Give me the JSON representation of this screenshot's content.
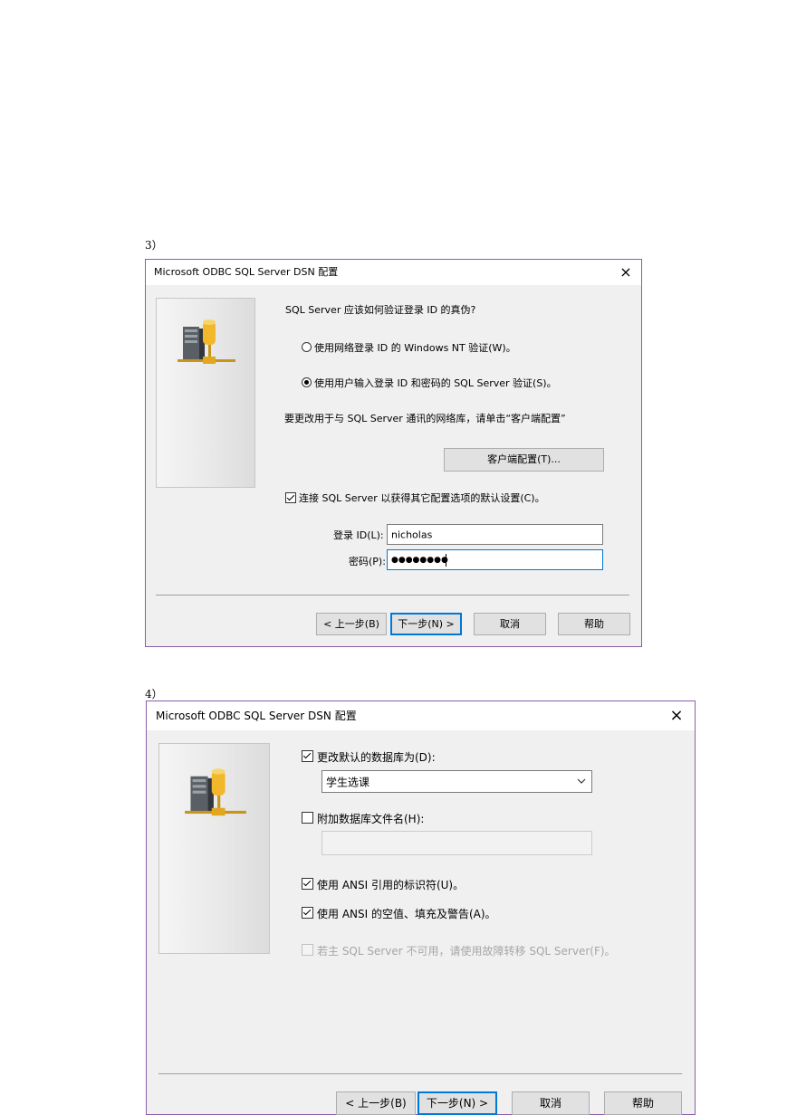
{
  "steps": {
    "step3_label": "3）",
    "step4_label": "4）"
  },
  "dialog3": {
    "title": "Microsoft ODBC SQL Server DSN 配置",
    "close_glyph": "×",
    "question": "SQL Server 应该如何验证登录 ID 的真伪?",
    "radio_windows_label": "使用网络登录 ID 的 Windows NT 验证(W)。",
    "radio_sql_label": "使用用户输入登录 ID 和密码的 SQL Server 验证(S)。",
    "radio_selected": "sql",
    "network_info": "要更改用于与 SQL Server 通讯的网络库，请单击“客户端配置”",
    "client_config_label": "客户端配置(T)...",
    "connect_checkbox_label": "连接 SQL Server 以获得其它配置选项的默认设置(C)。",
    "connect_checked": true,
    "login_label": "登录 ID(L):",
    "login_value": "nicholas",
    "password_label": "密码(P):",
    "password_mask": "●●●●●●●●",
    "buttons": {
      "back": "< 上一步(B)",
      "next": "下一步(N) >",
      "cancel": "取消",
      "help": "帮助"
    }
  },
  "dialog4": {
    "title": "Microsoft ODBC SQL Server DSN 配置",
    "close_glyph": "×",
    "change_db_label": "更改默认的数据库为(D):",
    "change_db_checked": true,
    "database_value": "学生选课",
    "attach_db_label": "附加数据库文件名(H):",
    "attach_db_checked": false,
    "attach_db_value": "",
    "ansi_quoted_label": "使用 ANSI 引用的标识符(U)。",
    "ansi_quoted_checked": true,
    "ansi_nulls_label": "使用 ANSI 的空值、填充及警告(A)。",
    "ansi_nulls_checked": true,
    "failover_label": "若主 SQL Server 不可用，请使用故障转移 SQL Server(F)。",
    "failover_checked": false,
    "buttons": {
      "back": "< 上一步(B)",
      "next": "下一步(N) >",
      "cancel": "取消",
      "help": "帮助"
    }
  },
  "icons": {
    "server": "server-network-icon",
    "dropdown": "chevron-down-icon",
    "close": "close-icon"
  },
  "colors": {
    "focus_border": "#0078d7",
    "dialog_border": "#8a5ea8",
    "dialog_bg": "#f0f0f0"
  }
}
